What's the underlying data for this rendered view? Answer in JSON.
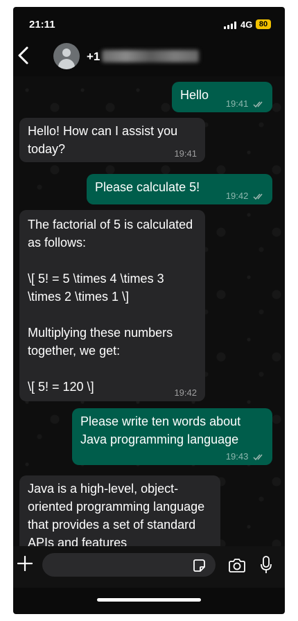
{
  "status_bar": {
    "time": "21:11",
    "network": "4G",
    "battery": "80"
  },
  "header": {
    "contact_name": "+1"
  },
  "messages": [
    {
      "direction": "out",
      "text": "Hello",
      "time": "19:41"
    },
    {
      "direction": "in",
      "text": "Hello! How can I assist you today?",
      "time": "19:41"
    },
    {
      "direction": "out",
      "text": "Please calculate 5!",
      "time": "19:42"
    },
    {
      "direction": "in",
      "text": "The factorial of 5 is calculated as follows:\n\n\\[ 5! = 5 \\times 4 \\times 3 \\times 2 \\times 1 \\]\n\nMultiplying these numbers together, we get:\n\n\\[ 5! = 120 \\]",
      "time": "19:42"
    },
    {
      "direction": "out",
      "text": "Please write ten words about Java programming language",
      "time": "19:43"
    },
    {
      "direction": "in",
      "text": "Java is a high-level, object-oriented programming language that provides a set of standard APIs and features",
      "time": ""
    }
  ],
  "input": {
    "placeholder": ""
  },
  "colors": {
    "outgoing_bubble": "#005d4b",
    "incoming_bubble": "#262628",
    "battery": "#f2c200"
  }
}
